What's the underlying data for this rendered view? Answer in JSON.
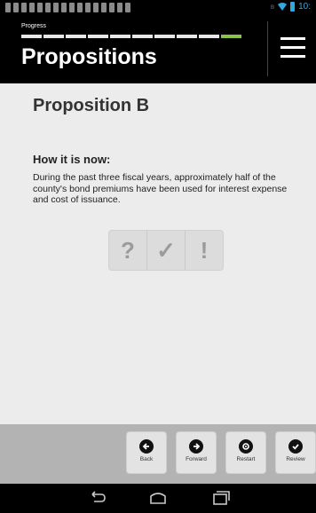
{
  "status_bar": {
    "notification_icons": [
      "download-icon",
      "image-icon",
      "download-icon",
      "download-icon",
      "download-icon",
      "download-icon",
      "download-icon",
      "download-icon",
      "download-icon",
      "download-icon",
      "download-icon",
      "download-icon",
      "calendar-icon",
      "download-icon",
      "download-icon",
      "download-icon"
    ],
    "indicator_icons": [
      "bluetooth-icon",
      "wifi-icon",
      "battery-icon"
    ],
    "time": "10:"
  },
  "header": {
    "progress_label": "Progress",
    "progress_total": 10,
    "progress_current": 10,
    "title": "Propositions",
    "menu_icon": "hamburger-menu-icon"
  },
  "content": {
    "proposition_title": "Proposition B",
    "section_heading": "How it is now:",
    "section_body": "During the past three fiscal years, approximately half of the county's bond premiums have been used for interest expense and cost of issuance.",
    "answer_options": [
      {
        "label": "?",
        "meaning": "question-mark-icon"
      },
      {
        "label": "✓",
        "meaning": "checkmark-icon"
      },
      {
        "label": "!",
        "meaning": "exclamation-icon"
      }
    ]
  },
  "footer": {
    "buttons": [
      {
        "label": "Back",
        "icon": "arrow-left-icon"
      },
      {
        "label": "Forward",
        "icon": "arrow-right-icon"
      },
      {
        "label": "Restart",
        "icon": "restart-icon"
      },
      {
        "label": "Review",
        "icon": "check-icon"
      }
    ]
  },
  "system_nav": [
    "back-icon",
    "home-icon",
    "recent-apps-icon"
  ],
  "colors": {
    "header_bg": "#000000",
    "content_bg": "#ececec",
    "footer_bg": "#b3b3b3",
    "progress_current": "#8bc34a",
    "status_accent": "#2fa9e0"
  }
}
